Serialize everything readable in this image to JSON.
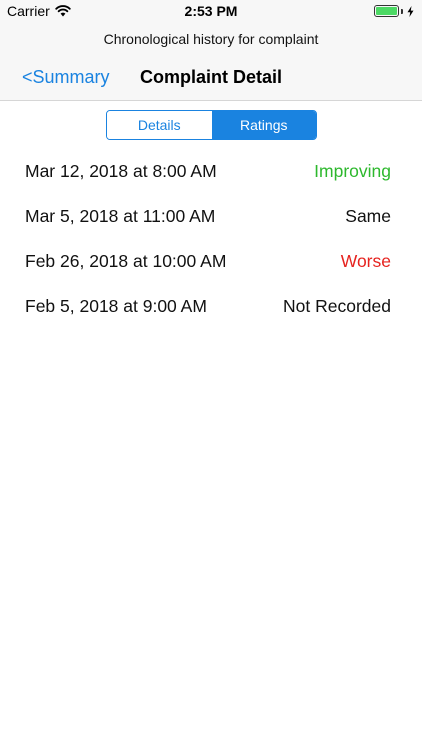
{
  "status_bar": {
    "carrier": "Carrier",
    "time": "2:53 PM",
    "battery_color": "#4cd964"
  },
  "nav": {
    "prompt": "Chronological history for complaint",
    "back_label": "<Summary",
    "title": "Complaint Detail"
  },
  "segments": {
    "options": [
      "Details",
      "Ratings"
    ],
    "selected": "Ratings"
  },
  "ratings": [
    {
      "date": "Mar 12, 2018 at 8:00 AM",
      "rating": "Improving",
      "color": "#2db82d"
    },
    {
      "date": "Mar 5, 2018 at 11:00 AM",
      "rating": "Same",
      "color": "#111111"
    },
    {
      "date": "Feb 26, 2018 at 10:00 AM",
      "rating": "Worse",
      "color": "#e6231f"
    },
    {
      "date": "Feb 5, 2018 at 9:00 AM",
      "rating": "Not Recorded",
      "color": "#111111"
    }
  ],
  "colors": {
    "accent": "#1a83e0"
  }
}
